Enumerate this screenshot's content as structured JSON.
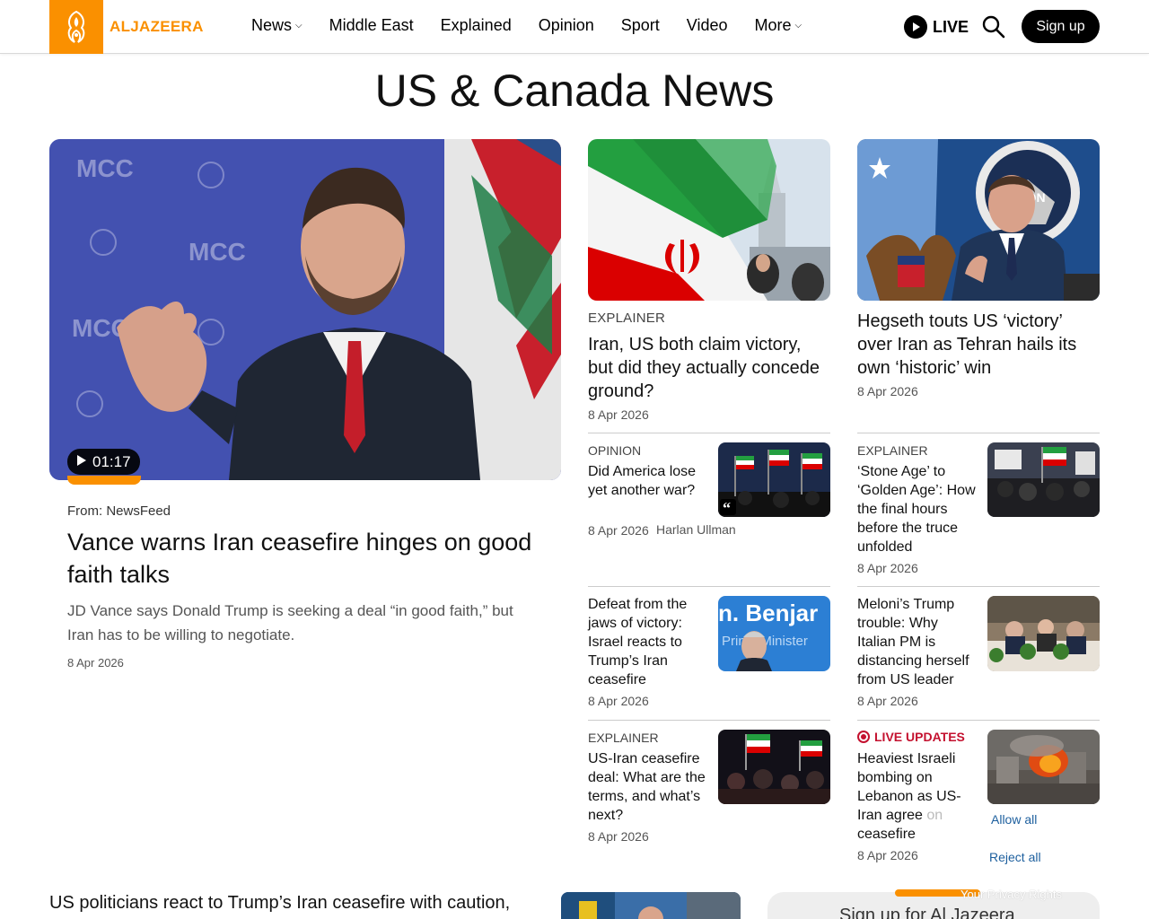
{
  "header": {
    "logo_text": "ALJAZEERA",
    "nav": [
      {
        "label": "News",
        "has_dropdown": true
      },
      {
        "label": "Middle East",
        "has_dropdown": false
      },
      {
        "label": "Explained",
        "has_dropdown": false
      },
      {
        "label": "Opinion",
        "has_dropdown": false
      },
      {
        "label": "Sport",
        "has_dropdown": false
      },
      {
        "label": "Video",
        "has_dropdown": false
      },
      {
        "label": "More",
        "has_dropdown": true
      }
    ],
    "live_label": "LIVE",
    "signup_label": "Sign up"
  },
  "page_title": "US & Canada News",
  "lead": {
    "video_duration": "01:17",
    "from": "From: NewsFeed",
    "headline": "Vance warns Iran ceasefire hinges on good faith talks",
    "summary": "JD Vance says Donald Trump is seeking a deal “in good faith,” but Iran has to be willing to negotiate.",
    "date": "8 Apr 2026"
  },
  "top_cards": [
    {
      "kicker": "EXPLAINER",
      "headline": "Iran, US both claim victory, but did they actually concede ground?",
      "date": "8 Apr 2026"
    },
    {
      "kicker": "",
      "headline": "Hegseth touts US ‘victory’ over Iran as Tehran hails its own ‘historic’ win",
      "date": "8 Apr 2026"
    }
  ],
  "small_cards": [
    {
      "kicker": "OPINION",
      "headline": "Did America lose yet another war?",
      "date": "8 Apr 2026",
      "author": "Harlan Ullman"
    },
    {
      "kicker": "EXPLAINER",
      "headline": "‘Stone Age’ to ‘Golden Age’: How the final hours before the truce unfolded",
      "date": "8 Apr 2026"
    },
    {
      "kicker": "",
      "headline": "Defeat from the jaws of victory: Israel reacts to Trump’s Iran ceasefire",
      "date": "8 Apr 2026",
      "thumb_text_1": "n. Benjar",
      "thumb_text_2": "Prime Minister"
    },
    {
      "kicker": "",
      "headline": "Meloni’s Trump trouble: Why Italian PM is distancing herself from US leader",
      "date": "8 Apr 2026"
    },
    {
      "kicker": "EXPLAINER",
      "headline": "US-Iran ceasefire deal: What are the terms, and what’s next?",
      "date": "8 Apr 2026"
    },
    {
      "kicker": "LIVE UPDATES",
      "headline_main": "Heaviest Israeli bombing on Lebanon as US-Iran agree",
      "headline_faded": "on",
      "headline_end": "ceasefire",
      "date": "8 Apr 2026"
    }
  ],
  "cookie": {
    "allow_all": "Allow all",
    "reject_all": "Reject all",
    "privacy_rights": "Your Privacy Rights"
  },
  "bottom": {
    "headline": "US politicians react to Trump’s Iran ceasefire with caution,",
    "newsletter": "Sign up for Al Jazeera"
  },
  "colors": {
    "brand_orange": "#fa9000",
    "live_red": "#c4112f",
    "link_blue": "#1d5f9e"
  }
}
